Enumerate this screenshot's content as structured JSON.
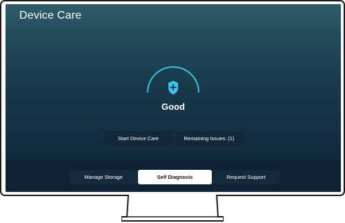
{
  "app": {
    "title": "Device Care"
  },
  "status": {
    "label": "Good",
    "icon": "shield-plus-icon",
    "accent_color": "#3ec3e6"
  },
  "actions": {
    "start_label": "Start Device Care",
    "issues_label": "Remaining Issues: (1)"
  },
  "tabs": [
    {
      "label": "Manage Storage",
      "selected": false
    },
    {
      "label": "Self Diagnosis",
      "selected": true
    },
    {
      "label": "Request Support",
      "selected": false
    }
  ]
}
